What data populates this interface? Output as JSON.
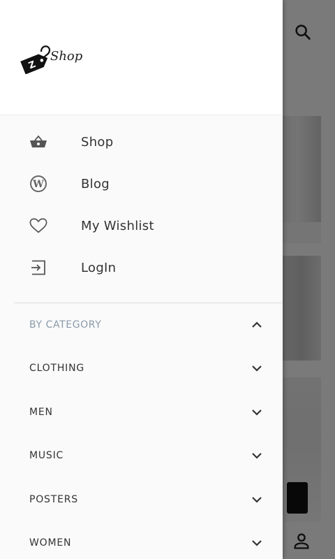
{
  "app": {
    "logo_text": "Shop"
  },
  "menu": [
    {
      "label": "Shop",
      "icon": "basket-icon"
    },
    {
      "label": "Blog",
      "icon": "wordpress-icon"
    },
    {
      "label": "My Wishlist",
      "icon": "heart-icon"
    },
    {
      "label": "LogIn",
      "icon": "login-icon"
    }
  ],
  "categories": {
    "title": "BY CATEGORY",
    "items": [
      "CLOTHING",
      "MEN",
      "MUSIC",
      "POSTERS",
      "WOMEN"
    ]
  },
  "colors": {
    "accent": "#8a9aa9",
    "text": "#333333",
    "icon": "#444444"
  }
}
